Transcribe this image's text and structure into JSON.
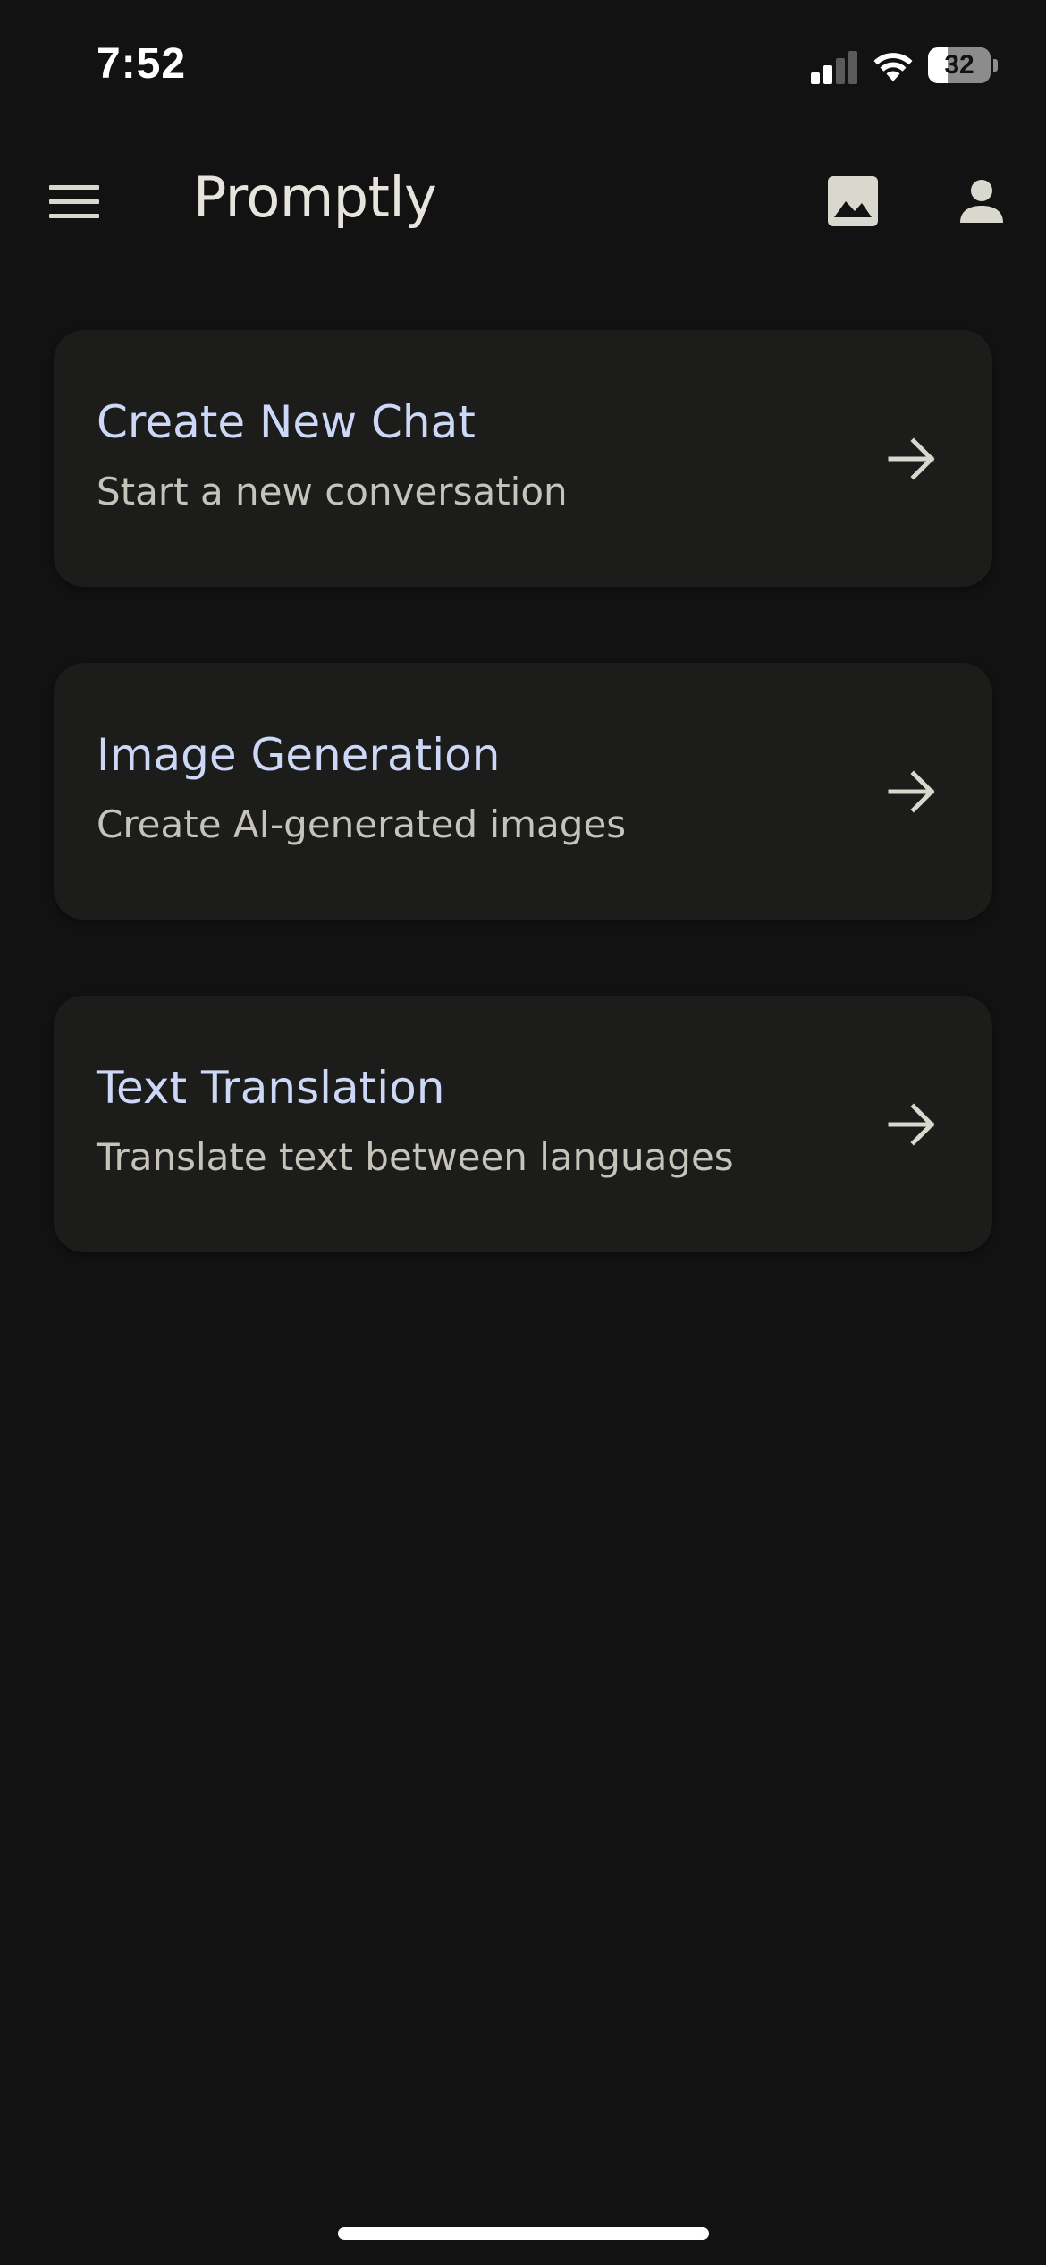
{
  "status_bar": {
    "time": "7:52",
    "battery_level": "32",
    "battery_fraction": 0.32,
    "icons": [
      "signal-icon",
      "wifi-icon",
      "battery-icon"
    ]
  },
  "app_bar": {
    "title": "Promptly",
    "icons": [
      "menu-icon",
      "image-icon",
      "account-icon"
    ]
  },
  "cards": [
    {
      "title": "Create New Chat",
      "subtitle": "Start a new conversation",
      "icon": "arrow-right-icon"
    },
    {
      "title": "Image Generation",
      "subtitle": "Create AI-generated images",
      "icon": "arrow-right-icon"
    },
    {
      "title": "Text Translation",
      "subtitle": "Translate text between languages",
      "icon": "arrow-right-icon"
    }
  ],
  "colors": {
    "background": "#121212",
    "card_background": "#1c1d1a",
    "card_title": "#cdd8f8",
    "card_subtitle": "#c5c3ba",
    "icon": "#d9d8cf"
  }
}
